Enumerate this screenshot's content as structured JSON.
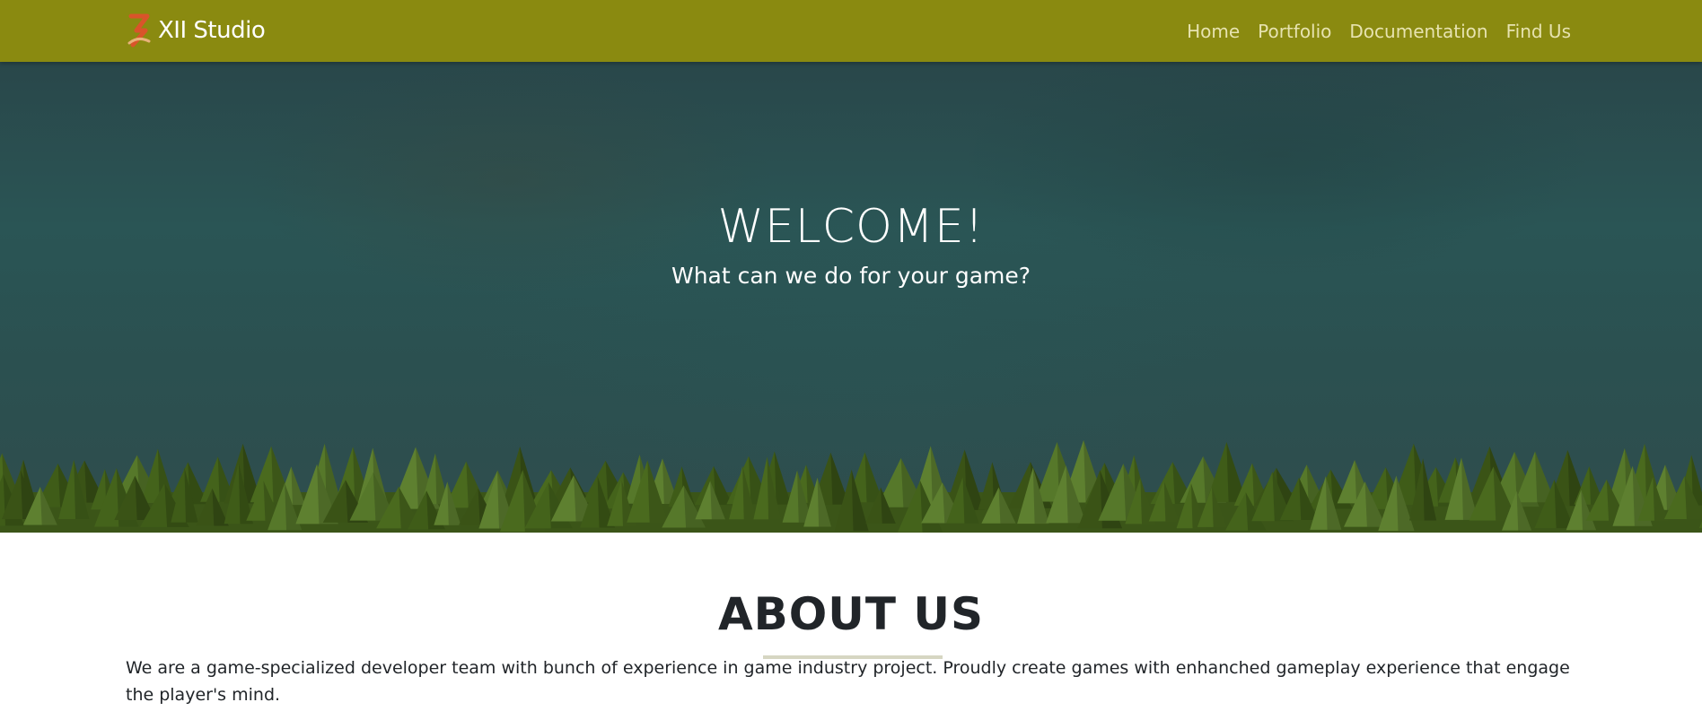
{
  "brand": {
    "name": "XII Studio",
    "logo": "xii-studio-logo"
  },
  "nav": {
    "items": [
      {
        "label": "Home"
      },
      {
        "label": "Portfolio"
      },
      {
        "label": "Documentation"
      },
      {
        "label": "Find Us"
      }
    ]
  },
  "hero": {
    "title": "WELCOME!",
    "subtitle": "What can we do for your game?"
  },
  "about": {
    "title": "ABOUT US",
    "text": "We are a game-specialized developer team with bunch of experience in game industry project. Proudly create games with enhanched gameplay experience that engage the player's mind."
  },
  "colors": {
    "navbar": "#8a8a10",
    "nav_link": "#e7e3b0",
    "hero": "#2a5555",
    "trees": "#4a6a1e"
  }
}
